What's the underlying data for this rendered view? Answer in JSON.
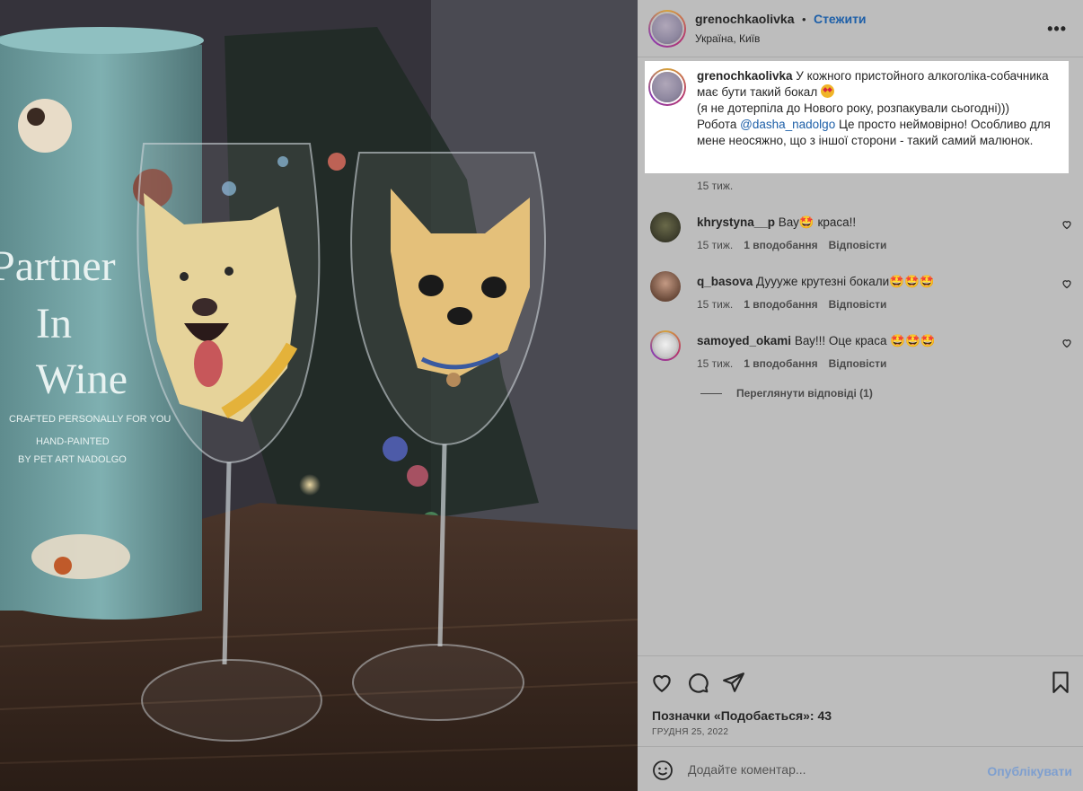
{
  "post": {
    "username": "grenochkaolivka",
    "follow_label": "Стежити",
    "dot": "•",
    "location": "Україна, Київ",
    "more_label": "•••",
    "caption_line1": " У кожного пристойного алкоголіка-собачника має бути такий бокал ",
    "caption_line2": "(я не дотерпіла до Нового року, розпакували сьогодні)))",
    "caption_line3_a": "Робота ",
    "caption_mention": "@dasha_nadolgo",
    "caption_line3_b": " Це просто неймовірно! Особливо для мене неосяжно, що з іншої сторони - такий самий малюнок.",
    "caption_time": "15 тиж.",
    "likes_text": "Позначки «Подобається»: 43",
    "date": "ГРУДНЯ 25, 2022"
  },
  "comments": [
    {
      "username": "khrystyna__p",
      "text": " Вау🤩 краса!!",
      "time": "15 тиж.",
      "likes": "1 вподобання",
      "reply": "Відповісти"
    },
    {
      "username": "q_basova",
      "text": " Дуууже крутезні бокали🤩🤩🤩",
      "time": "15 тиж.",
      "likes": "1 вподобання",
      "reply": "Відповісти"
    },
    {
      "username": "samoyed_okami",
      "text": " Вау!!! Оце краса 🤩🤩🤩",
      "time": "15 тиж.",
      "likes": "1 вподобання",
      "reply": "Відповісти"
    }
  ],
  "view_replies": "Переглянути відповіді (1)",
  "comment_box": {
    "placeholder": "Додайте коментар...",
    "publish": "Опублікувати"
  },
  "photo": {
    "tube_text_1": "Partner",
    "tube_text_2": "In",
    "tube_text_3": "Wine",
    "tube_small_1": "CRAFTED PERSONALLY FOR YOU",
    "tube_small_2": "HAND-PAINTED",
    "tube_small_3": "BY PET ART NADOLGO"
  },
  "colors": {
    "link": "#1d5fa8",
    "panel_dim": "#bdbdbd",
    "caption_highlight": "#ffffff"
  }
}
